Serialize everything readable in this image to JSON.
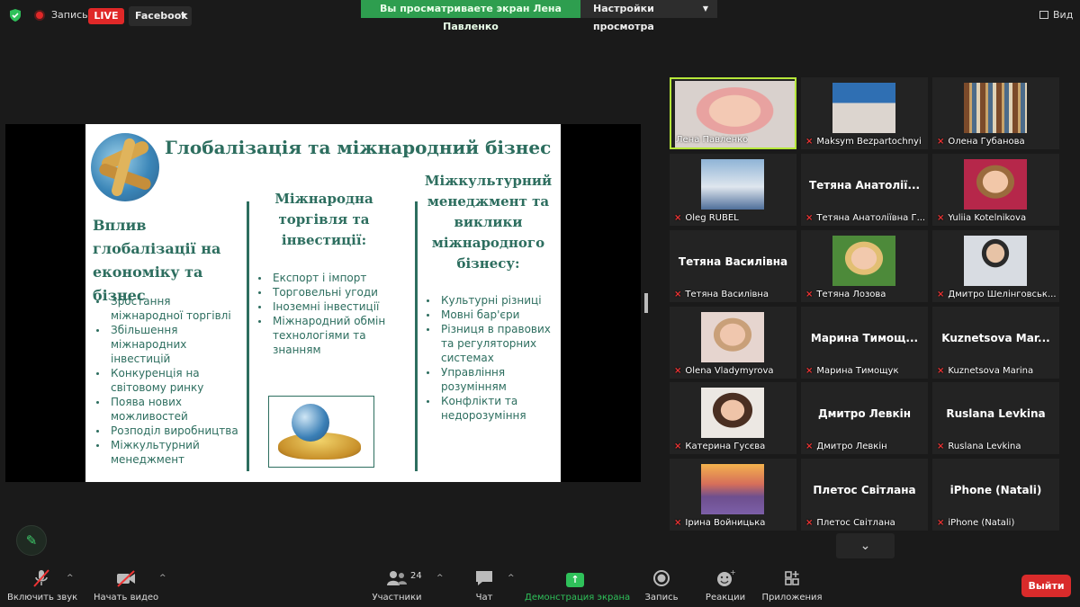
{
  "topbar": {
    "record_label": "Запись",
    "live_label": "LIVE",
    "stream_target": "Facebook",
    "share_banner": "Вы просматриваете экран Лена Павленко",
    "view_options": "Настройки просмотра",
    "view_button": "Вид"
  },
  "slide": {
    "title": "Глобалізація та міжнародний бізнес",
    "left": {
      "heading": "Вплив глобалізації на економіку та бізнес",
      "items": [
        "Зростання міжнародної торгівлі",
        "Збільшення міжнародних інвестицій",
        "Конкуренція на світовому ринку",
        "Поява нових можливостей",
        "Розподіл виробництва",
        "Міжкультурний менеджмент"
      ]
    },
    "middle": {
      "heading": "Міжнародна торгівля та інвестиції:",
      "items": [
        "Експорт і імпорт",
        "Торговельні угоди",
        "Іноземні інвестиції",
        "Міжнародний обмін технологіями та знанням"
      ]
    },
    "right": {
      "heading": "Міжкультурний менеджмент та виклики міжнародного бізнесу:",
      "items": [
        "Культурні різниці",
        "Мовні бар'єри",
        "Різниця в правових та регуляторних системах",
        "Управління розумінням",
        "Конфлікти та недорозуміння"
      ]
    }
  },
  "gallery": [
    {
      "name": "Лена Павленко",
      "big": "",
      "muted": false,
      "active": true,
      "photo": "face-blonde"
    },
    {
      "name": "Maksym Bezpartochnyi",
      "big": "",
      "muted": true,
      "active": false,
      "photo": "face-man"
    },
    {
      "name": "Олена Губанова",
      "big": "",
      "muted": true,
      "active": false,
      "photo": "bookshelf"
    },
    {
      "name": "Oleg RUBEL",
      "big": "",
      "muted": true,
      "active": false,
      "photo": "sky"
    },
    {
      "name": "Тетяна Анатоліївна Г...",
      "big": "Тетяна  Анатолії...",
      "muted": true,
      "active": false,
      "photo": ""
    },
    {
      "name": "Yuliia Kotelnikova",
      "big": "",
      "muted": true,
      "active": false,
      "photo": "face-glasses"
    },
    {
      "name": "Тетяна Василівна",
      "big": "Тетяна Василівна",
      "muted": true,
      "active": false,
      "photo": ""
    },
    {
      "name": "Тетяна Лозова",
      "big": "",
      "muted": true,
      "active": false,
      "photo": "face-blonde2"
    },
    {
      "name": "Дмитро Шелінговськ...",
      "big": "",
      "muted": true,
      "active": false,
      "photo": "face-suit"
    },
    {
      "name": "Olena Vladymyrova",
      "big": "",
      "muted": true,
      "active": false,
      "photo": "face-older"
    },
    {
      "name": "Марина Тимощук",
      "big": "Марина  Тимощ...",
      "muted": true,
      "active": false,
      "photo": ""
    },
    {
      "name": "Kuznetsova Marina",
      "big": "Kuznetsova  Mar...",
      "muted": true,
      "active": false,
      "photo": ""
    },
    {
      "name": "Катерина Гусєва",
      "big": "",
      "muted": true,
      "active": false,
      "photo": "face-dark"
    },
    {
      "name": "Дмитро Левкін",
      "big": "Дмитро Левкін",
      "muted": true,
      "active": false,
      "photo": ""
    },
    {
      "name": "Ruslana Levkina",
      "big": "Ruslana Levkina",
      "muted": true,
      "active": false,
      "photo": ""
    },
    {
      "name": "Ірина Войницька",
      "big": "",
      "muted": true,
      "active": false,
      "photo": "sunset"
    },
    {
      "name": "Плетос Світлана",
      "big": "Плетос Світлана",
      "muted": true,
      "active": false,
      "photo": ""
    },
    {
      "name": "iPhone (Natali)",
      "big": "iPhone (Natali)",
      "muted": true,
      "active": false,
      "photo": ""
    }
  ],
  "toolbar": {
    "unmute": "Включить звук",
    "start_video": "Начать видео",
    "participants": "Участники",
    "participants_count": "24",
    "chat": "Чат",
    "share_screen": "Демонстрация экрана",
    "record": "Запись",
    "reactions": "Реакции",
    "apps": "Приложения",
    "leave": "Выйти"
  },
  "colors": {
    "accent_green": "#2fc15a",
    "leave_red": "#d92b2b",
    "slide_text": "#2d6e5f",
    "active_border": "#b6e73a"
  }
}
